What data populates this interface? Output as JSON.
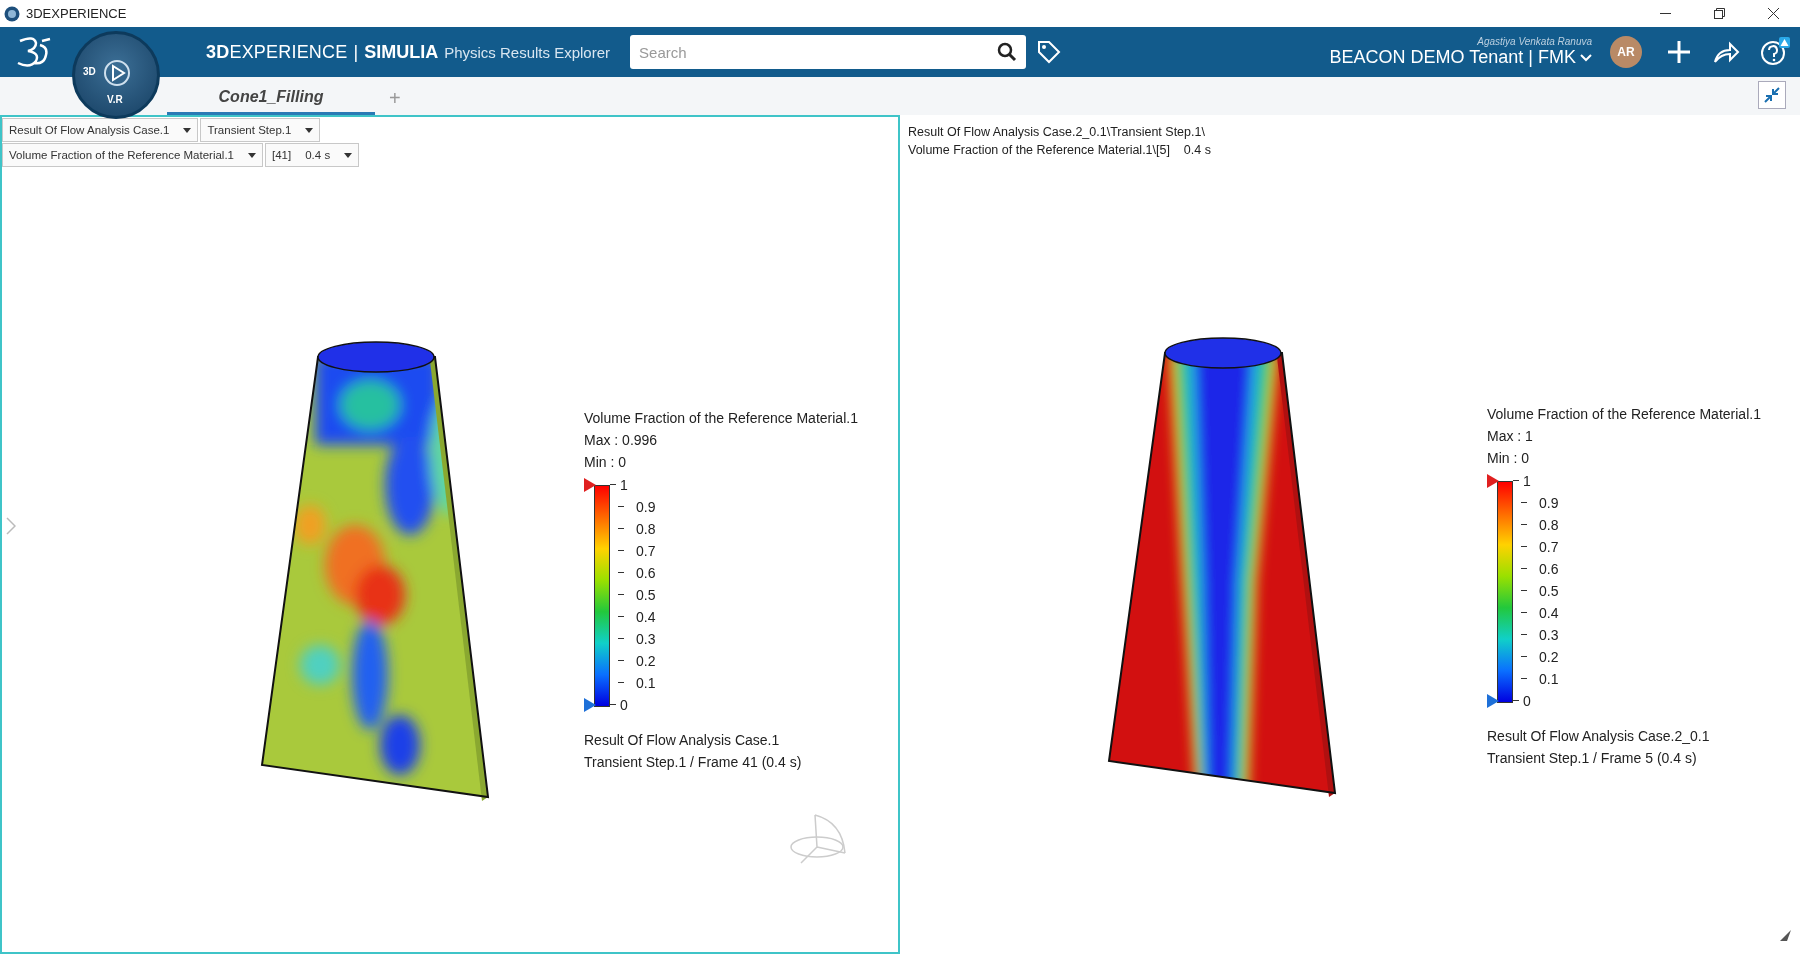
{
  "window": {
    "title": "3DEXPERIENCE"
  },
  "header": {
    "compass_labels": [
      "3D",
      "V.R"
    ],
    "brand": "**3D**EXPERIENCE",
    "separator": "|",
    "app_title": "SIMULIA",
    "app_subtitle": "Physics Results Explorer",
    "search": {
      "placeholder": "Search"
    },
    "user_name": "Agastiya Venkata Ranuva",
    "tenant": "BEACON DEMO Tenant | FMK",
    "avatar": "AR"
  },
  "tabs": [
    {
      "label": "Cone1_Filling",
      "selected": true
    }
  ],
  "add_tab": "+",
  "viewers": [
    {
      "active": true,
      "selectors": [
        [
          {
            "value": "Result Of Flow Analysis Case.1"
          },
          {
            "value": "Transient Step.1"
          }
        ],
        [
          {
            "value": "Volume Fraction of the Reference Material.1"
          },
          {
            "index": "[41]",
            "value": "0.4 s"
          }
        ]
      ],
      "legend": {
        "title": "Volume Fraction of the Reference Material.1",
        "max": "Max : 0.996",
        "min": "Min : 0",
        "ticks": [
          "1",
          "0.9",
          "0.8",
          "0.7",
          "0.6",
          "0.5",
          "0.4",
          "0.3",
          "0.2",
          "0.1",
          "0"
        ],
        "result": "Result Of Flow Analysis Case.1",
        "frame": "Transient Step.1 / Frame 41 (0.4 s)"
      }
    },
    {
      "active": false,
      "path_lines": [
        "Result Of Flow Analysis Case.2_0.1\\Transient Step.1\\",
        "Volume Fraction of the Reference Material.1\\[5]    0.4 s"
      ],
      "legend": {
        "title": "Volume Fraction of the Reference Material.1",
        "max": "Max : 1",
        "min": "Min : 0",
        "ticks": [
          "1",
          "0.9",
          "0.8",
          "0.7",
          "0.6",
          "0.5",
          "0.4",
          "0.3",
          "0.2",
          "0.1",
          "0"
        ],
        "result": "Result Of Flow Analysis Case.2_0.1",
        "frame": "Transient Step.1 / Frame 5 (0.4 s)"
      }
    }
  ]
}
